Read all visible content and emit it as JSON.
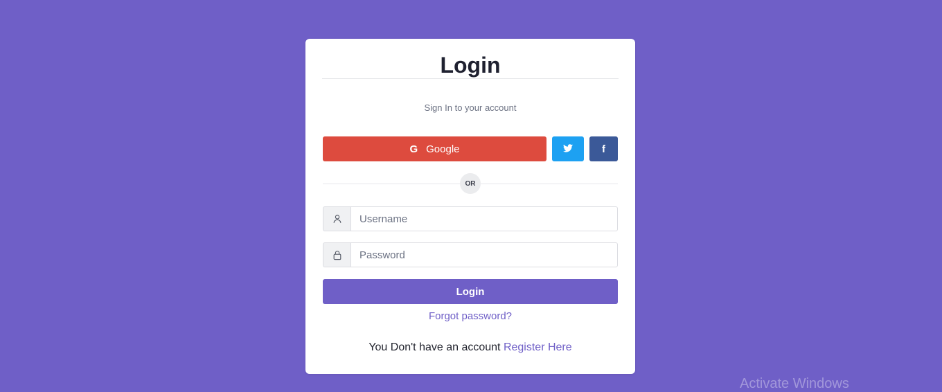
{
  "login_card": {
    "title": "Login",
    "subtitle": "Sign In to your account",
    "google_label": "Google",
    "google_icon": "G",
    "twitter_icon": "twitter-icon",
    "facebook_icon": "f",
    "or_label": "OR",
    "username_placeholder": "Username",
    "password_placeholder": "Password",
    "login_button_label": "Login",
    "forgot_link": "Forgot password?",
    "register_prompt": "You Don't have an account",
    "register_link": "Register Here"
  },
  "watermark": {
    "text": "Activate Windows"
  },
  "colors": {
    "background": "#6f5fc7",
    "accent": "#6f5fc7",
    "google": "#dd4b3e",
    "twitter": "#1da1f2",
    "facebook": "#3b5998"
  }
}
